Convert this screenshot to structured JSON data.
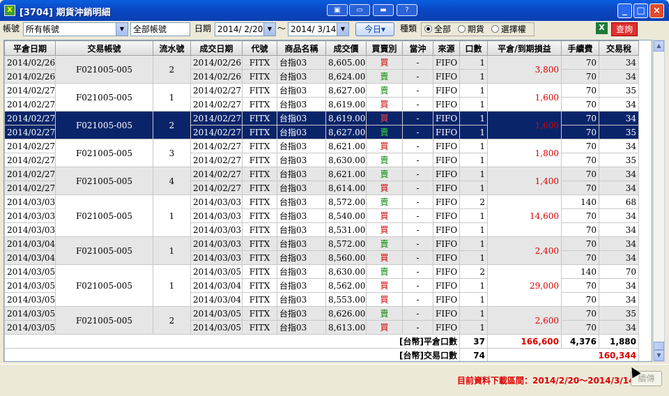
{
  "window": {
    "title": "[3704] 期貨沖銷明細",
    "icon": "app-icon"
  },
  "titlebar_buttons": [
    "▣",
    "▭",
    "▬",
    "?"
  ],
  "toolbar": {
    "account_label": "帳號",
    "account_value": "所有帳號",
    "account_text": "全部帳號",
    "date_label": "日期",
    "date_from": "2014/ 2/20",
    "tilde": "～",
    "date_to": "2014/ 3/14",
    "today_button": "今日▾",
    "type_label": "種類",
    "radio_all": "全部",
    "radio_futures": "期貨",
    "radio_options": "選擇權",
    "excel_icon": "X",
    "query_button": "查詢"
  },
  "table": {
    "columns": [
      "平倉日期",
      "交易帳號",
      "流水號",
      "成交日期",
      "代號",
      "商品名稱",
      "成交價",
      "買賣別",
      "當沖",
      "來源",
      "口數",
      "平倉/到期損益",
      "手續費",
      "交易稅"
    ],
    "groups": [
      {
        "style": "gB",
        "account": "F021005-005",
        "serial": "2",
        "pnl": "3,800",
        "rows": [
          [
            "2014/02/26",
            "2014/02/26",
            "FITX",
            "台指03",
            "8,605.00",
            "買",
            "-",
            "FIFO",
            "1",
            "70",
            "34"
          ],
          [
            "2014/02/26",
            "2014/02/26",
            "FITX",
            "台指03",
            "8,624.00",
            "賣",
            "-",
            "FIFO",
            "1",
            "70",
            "34"
          ]
        ]
      },
      {
        "style": "gA",
        "account": "F021005-005",
        "serial": "1",
        "pnl": "1,600",
        "rows": [
          [
            "2014/02/27",
            "2014/02/27",
            "FITX",
            "台指03",
            "8,627.00",
            "賣",
            "-",
            "FIFO",
            "1",
            "70",
            "35"
          ],
          [
            "2014/02/27",
            "2014/02/27",
            "FITX",
            "台指03",
            "8,619.00",
            "買",
            "-",
            "FIFO",
            "1",
            "70",
            "34"
          ]
        ]
      },
      {
        "style": "gS",
        "account": "F021005-005",
        "serial": "2",
        "pnl": "1,600",
        "rows": [
          [
            "2014/02/27",
            "2014/02/27",
            "FITX",
            "台指03",
            "8,619.00",
            "買",
            "-",
            "FIFO",
            "1",
            "70",
            "34"
          ],
          [
            "2014/02/27",
            "2014/02/27",
            "FITX",
            "台指03",
            "8,627.00",
            "賣",
            "-",
            "FIFO",
            "1",
            "70",
            "35"
          ]
        ]
      },
      {
        "style": "gA",
        "account": "F021005-005",
        "serial": "3",
        "pnl": "1,800",
        "rows": [
          [
            "2014/02/27",
            "2014/02/27",
            "FITX",
            "台指03",
            "8,621.00",
            "買",
            "-",
            "FIFO",
            "1",
            "70",
            "34"
          ],
          [
            "2014/02/27",
            "2014/02/27",
            "FITX",
            "台指03",
            "8,630.00",
            "賣",
            "-",
            "FIFO",
            "1",
            "70",
            "35"
          ]
        ]
      },
      {
        "style": "gB",
        "account": "F021005-005",
        "serial": "4",
        "pnl": "1,400",
        "rows": [
          [
            "2014/02/27",
            "2014/02/27",
            "FITX",
            "台指03",
            "8,621.00",
            "賣",
            "-",
            "FIFO",
            "1",
            "70",
            "34"
          ],
          [
            "2014/02/27",
            "2014/02/27",
            "FITX",
            "台指03",
            "8,614.00",
            "買",
            "-",
            "FIFO",
            "1",
            "70",
            "34"
          ]
        ]
      },
      {
        "style": "gA",
        "account": "F021005-005",
        "serial": "1",
        "pnl": "14,600",
        "rows": [
          [
            "2014/03/03",
            "2014/03/03",
            "FITX",
            "台指03",
            "8,572.00",
            "賣",
            "-",
            "FIFO",
            "2",
            "140",
            "68"
          ],
          [
            "2014/03/03",
            "2014/03/03",
            "FITX",
            "台指03",
            "8,540.00",
            "買",
            "-",
            "FIFO",
            "1",
            "70",
            "34"
          ],
          [
            "2014/03/03",
            "2014/03/03",
            "FITX",
            "台指03",
            "8,531.00",
            "買",
            "-",
            "FIFO",
            "1",
            "70",
            "34"
          ]
        ]
      },
      {
        "style": "gB",
        "account": "F021005-005",
        "serial": "1",
        "pnl": "2,400",
        "rows": [
          [
            "2014/03/04",
            "2014/03/03",
            "FITX",
            "台指03",
            "8,572.00",
            "賣",
            "-",
            "FIFO",
            "1",
            "70",
            "34"
          ],
          [
            "2014/03/04",
            "2014/03/03",
            "FITX",
            "台指03",
            "8,560.00",
            "買",
            "-",
            "FIFO",
            "1",
            "70",
            "34"
          ]
        ]
      },
      {
        "style": "gA",
        "account": "F021005-005",
        "serial": "1",
        "pnl": "29,000",
        "rows": [
          [
            "2014/03/05",
            "2014/03/05",
            "FITX",
            "台指03",
            "8,630.00",
            "賣",
            "-",
            "FIFO",
            "2",
            "140",
            "70"
          ],
          [
            "2014/03/05",
            "2014/03/04",
            "FITX",
            "台指03",
            "8,562.00",
            "買",
            "-",
            "FIFO",
            "1",
            "70",
            "34"
          ],
          [
            "2014/03/05",
            "2014/03/04",
            "FITX",
            "台指03",
            "8,553.00",
            "買",
            "-",
            "FIFO",
            "1",
            "70",
            "34"
          ]
        ]
      },
      {
        "style": "gB",
        "account": "F021005-005",
        "serial": "2",
        "pnl": "2,600",
        "rows": [
          [
            "2014/03/05",
            "2014/03/05",
            "FITX",
            "台指03",
            "8,626.00",
            "賣",
            "-",
            "FIFO",
            "1",
            "70",
            "35"
          ],
          [
            "2014/03/05",
            "2014/03/05",
            "FITX",
            "台指03",
            "8,613.00",
            "買",
            "-",
            "FIFO",
            "1",
            "70",
            "34"
          ]
        ]
      }
    ],
    "summary": [
      {
        "label": "[台幣]平倉口數",
        "count": "37",
        "pnl": "166,600",
        "fee": "4,376",
        "tax": "1,880"
      },
      {
        "label": "[台幣]交易口數",
        "count": "74",
        "total": "160,344"
      }
    ]
  },
  "footer": {
    "range_text": "目前資料下載區間：2014/2/20～2014/3/14",
    "resend_button": "續傳"
  }
}
